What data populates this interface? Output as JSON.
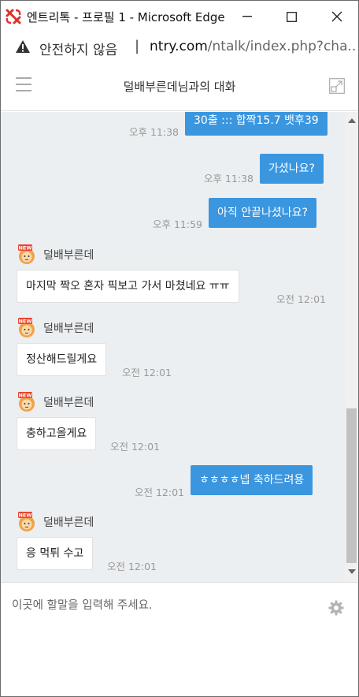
{
  "window": {
    "title": "엔트리톡 - 프로필 1 - Microsoft Edge"
  },
  "addressbar": {
    "security_label": "안전하지 않음",
    "separator": "|",
    "url_host": "ntry.com",
    "url_path": "/ntalk/index.php?cha..."
  },
  "chat_header": {
    "title": "덜배부른데님과의 대화"
  },
  "messages": [
    {
      "type": "out",
      "text": "30출 ::: 합짝15.7 뱃후39",
      "time": "오후 11:38"
    },
    {
      "type": "out",
      "text": "가셨나요?",
      "time": "오후 11:38"
    },
    {
      "type": "out",
      "text": "아직 안끝나셨나요?",
      "time": "오후 11:59"
    },
    {
      "type": "in",
      "sender": "덜배부른데",
      "text": "마지막 짝오 혼자 픽보고 가서 마쳤네요 ㅠㅠ",
      "time": "오전 12:01"
    },
    {
      "type": "in",
      "sender": "덜배부른데",
      "text": "정산해드릴게요",
      "time": "오전 12:01"
    },
    {
      "type": "in",
      "sender": "덜배부른데",
      "text": "충하고올게요",
      "time": "오전 12:01"
    },
    {
      "type": "out",
      "text": "ㅎㅎㅎㅎ넵 축하드려용",
      "time": "오전 12:01"
    },
    {
      "type": "in",
      "sender": "덜배부른데",
      "text": "응 먹튀 수고",
      "time": "오전 12:01"
    }
  ],
  "avatar_badge": "NEW",
  "input": {
    "placeholder": "이곳에 할말을 입력해 주세요.",
    "value": ""
  },
  "colors": {
    "outgoing_bubble": "#3b96e0",
    "chat_background": "#eceff1",
    "brand_icon": "#d9342b"
  },
  "icons": [
    "app-logo-icon",
    "minimize-icon",
    "maximize-icon",
    "close-icon",
    "warning-icon",
    "hamburger-menu-icon",
    "popout-icon",
    "avatar-icon",
    "settings-gear-icon"
  ]
}
